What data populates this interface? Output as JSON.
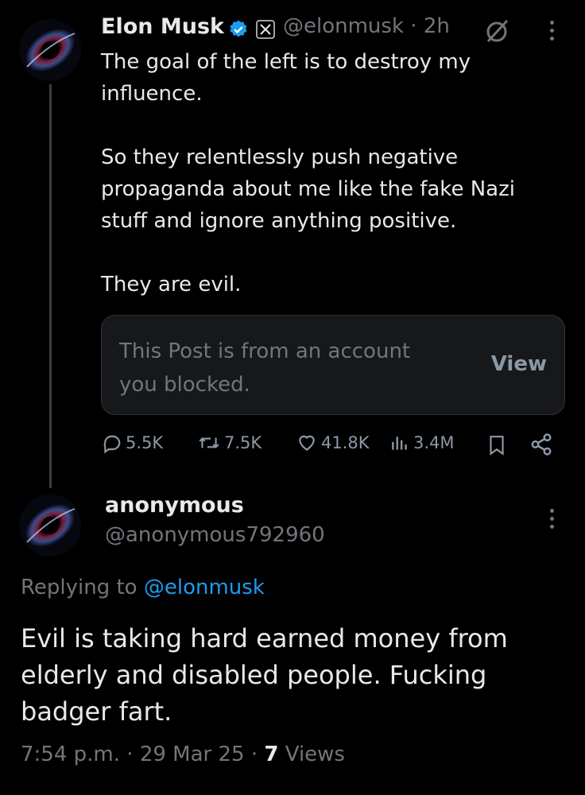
{
  "main_tweet": {
    "author_name": "Elon Musk",
    "handle": "@elonmusk",
    "separator": "·",
    "time": "2h",
    "paragraphs": [
      "The goal of the left is to destroy my influence.",
      "So they relentlessly push negative propaganda about me like the fake Nazi stuff and ignore anything positive.",
      "They are evil."
    ],
    "blocked_card": {
      "text": "This Post is from an account you blocked.",
      "button": "View"
    },
    "actions": {
      "replies": "5.5K",
      "reposts": "7.5K",
      "likes": "41.8K",
      "views": "3.4M"
    },
    "icons": [
      "verified-badge-icon",
      "x-logo-icon",
      "grok-icon",
      "more-icon"
    ]
  },
  "reply_tweet": {
    "author_name": "anonymous",
    "handle": "@anonymous792960",
    "replying_prefix": "Replying to",
    "replying_handle": "@elonmusk",
    "text": "Evil is taking hard earned money from elderly and disabled people. Fucking badger fart.",
    "time": "7:54 p.m.",
    "date": "29 Mar 25",
    "separator": "·",
    "views_count": "7",
    "views_label": "Views"
  },
  "colors": {
    "background": "#000000",
    "text": "#e7e9ea",
    "muted": "#71767b",
    "link": "#1d9bf0",
    "verified": "#1d9bf0"
  }
}
